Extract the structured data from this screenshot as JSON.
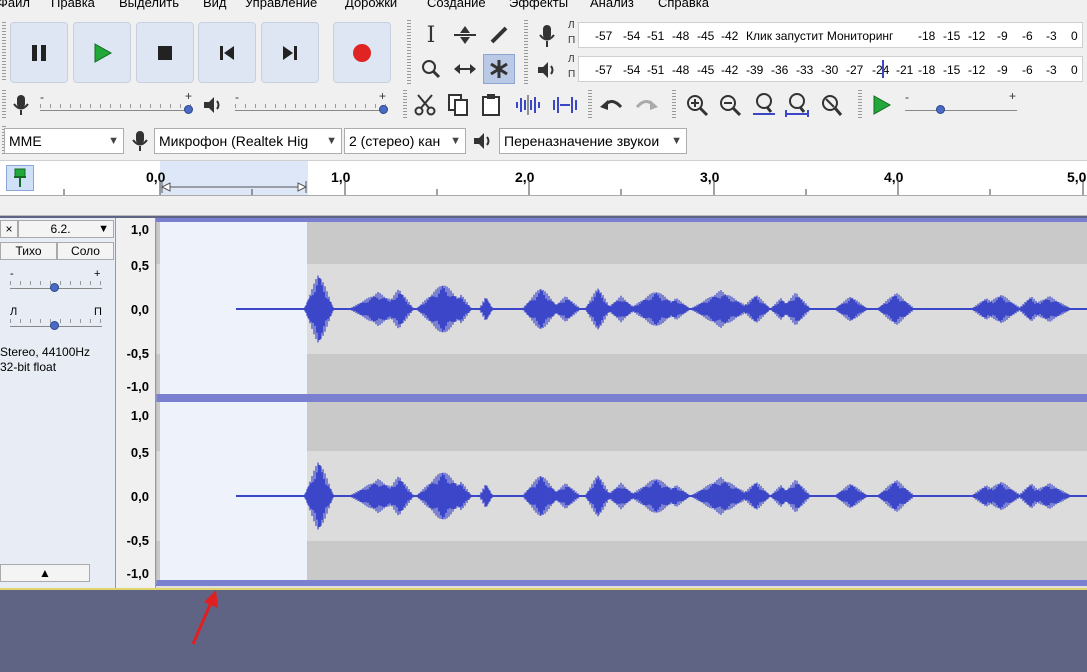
{
  "menu": [
    "Файл",
    "Правка",
    "Выделить",
    "Вид",
    "Управление",
    "Дорожки",
    "Создание",
    "Эффекты",
    "Анализ",
    "Справка"
  ],
  "transport": {
    "pause_icon": "pause-icon",
    "play_icon": "play-icon",
    "stop_icon": "stop-icon",
    "skip_start_icon": "skip-to-start-icon",
    "skip_end_icon": "skip-to-end-icon",
    "record_icon": "record-icon"
  },
  "meters": {
    "record_l": "Л",
    "record_r": "П",
    "play_l": "Л",
    "play_r": "П",
    "record_scale_left": [
      "-57",
      "-54",
      "-51",
      "-48",
      "-45",
      "-42"
    ],
    "record_message": "Клик запустит Мониторинг",
    "record_scale_right": [
      "-18",
      "-15",
      "-12",
      "-9",
      "-6",
      "-3",
      "0"
    ],
    "play_scale": [
      "-57",
      "-54",
      "-51",
      "-48",
      "-45",
      "-42",
      "-39",
      "-36",
      "-33",
      "-30",
      "-27",
      "-24",
      "-21",
      "-18",
      "-15",
      "-12",
      "-9",
      "-6",
      "-3",
      "0"
    ]
  },
  "mixer": {
    "minus": "-",
    "plus": "+"
  },
  "device": {
    "host": "MME",
    "input": "Микрофон (Realtek Hig",
    "channels": "2 (стерео) кан",
    "output": "Переназначение звукои"
  },
  "ruler": {
    "labels": [
      "0,0",
      "1,0",
      "2,0",
      "3,0",
      "4,0",
      "5,0"
    ]
  },
  "track": {
    "close": "×",
    "name": "6.2.",
    "mute": "Тихо",
    "solo": "Соло",
    "gain_minus": "-",
    "gain_plus": "+",
    "pan_left": "Л",
    "pan_right": "П",
    "info_line1": "Stereo, 44100Hz",
    "info_line2": "32-bit float",
    "collapse": "▲"
  },
  "vscale": {
    "top_channel": [
      "1,0",
      "0,5",
      "0,0",
      "-0,5",
      "-1,0"
    ],
    "bottom_channel": [
      "1,0",
      "0,5",
      "0,0",
      "-0,5",
      "-1,0"
    ]
  },
  "colors": {
    "waveform": "#3c47c8",
    "selection": "#eef3fb",
    "background_dark": "#5f6384",
    "annotation_arrow": "#e02020"
  }
}
